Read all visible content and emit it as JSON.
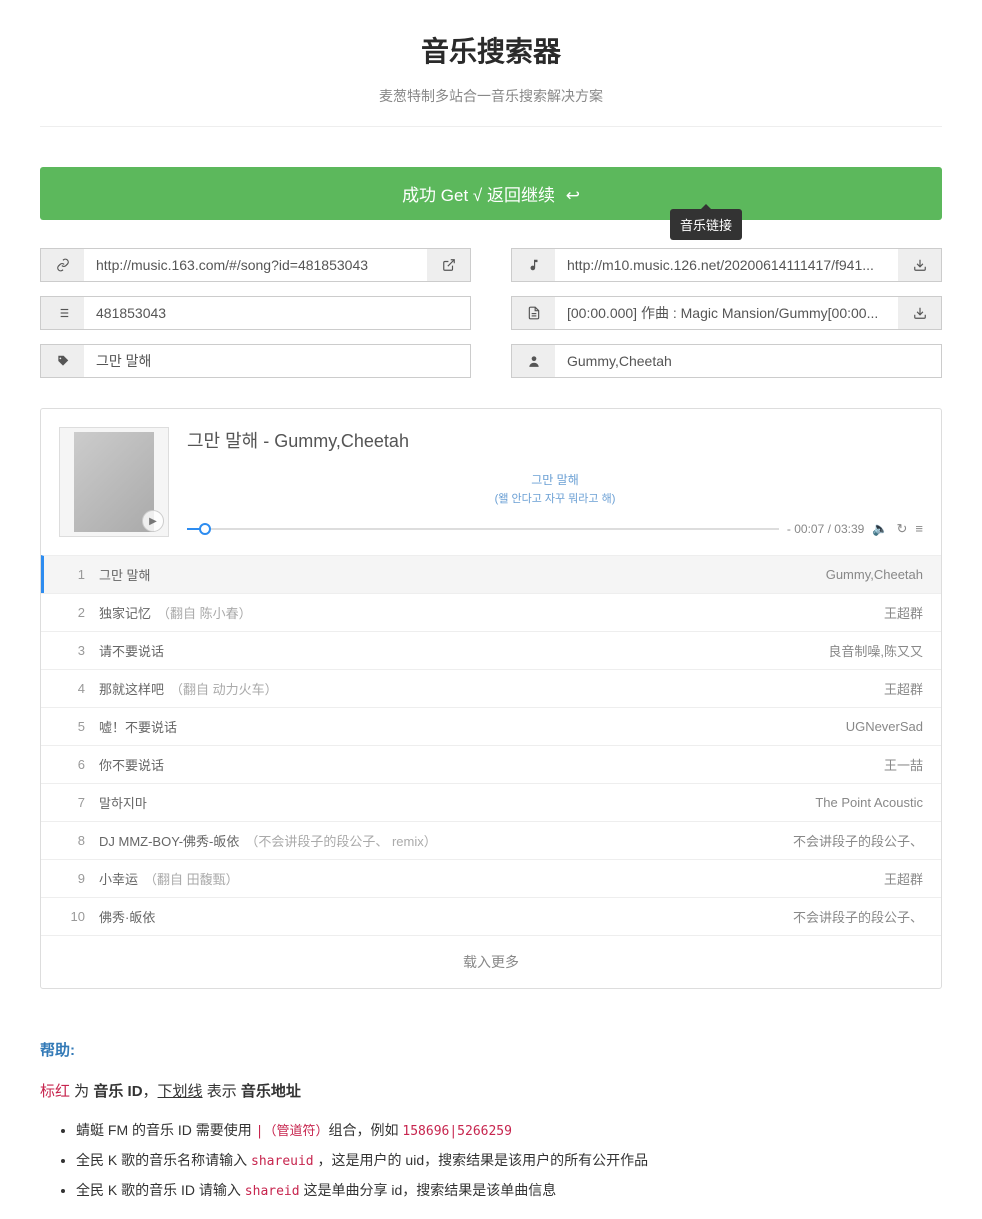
{
  "header": {
    "title": "音乐搜索器",
    "subtitle": "麦葱特制多站合一音乐搜索解决方案"
  },
  "alert": {
    "text": "成功 Get √ 返回继续 ",
    "tooltip": "音乐链接"
  },
  "fields": {
    "song_url": "http://music.163.com/#/song?id=481853043",
    "song_id": "481853043",
    "song_name": "그만 말해",
    "music_url": "http://m10.music.126.net/20200614111417/f941...",
    "lyric": "[00:00.000] 作曲 : Magic Mansion/Gummy[00:00...",
    "artist": "Gummy,Cheetah"
  },
  "player": {
    "title": "그만 말해 - Gummy,Cheetah",
    "lyric1": "그만 말해",
    "lyric2": "(왤 안다고 자꾸 뭐라고 해)",
    "time": "- 00:07 / 03:39"
  },
  "playlist": [
    {
      "num": "1",
      "title": "그만 말해",
      "artist": "Gummy,Cheetah",
      "active": true
    },
    {
      "num": "2",
      "title": "独家记忆",
      "secondary": "（翻自 陈小春）",
      "artist": "王超群"
    },
    {
      "num": "3",
      "title": "请不要说话",
      "artist": "良音制噪,陈又又"
    },
    {
      "num": "4",
      "title": "那就这样吧",
      "secondary": "（翻自 动力火车）",
      "artist": "王超群"
    },
    {
      "num": "5",
      "title": "嘘！不要说话",
      "artist": "UGNeverSad"
    },
    {
      "num": "6",
      "title": "你不要说话",
      "artist": "王一喆"
    },
    {
      "num": "7",
      "title": "말하지마",
      "artist": "The Point Acoustic"
    },
    {
      "num": "8",
      "title": "DJ MMZ-BOY-佛秀-皈依",
      "secondary": "（不会讲段子的段公子、 remix）",
      "artist": "不会讲段子的段公子、"
    },
    {
      "num": "9",
      "title": "小幸运",
      "secondary": "（翻自 田馥甄）",
      "artist": "王超群"
    },
    {
      "num": "10",
      "title": "佛秀·皈依",
      "artist": "不会讲段子的段公子、"
    }
  ],
  "load_more": "载入更多",
  "help": {
    "heading": "帮助:",
    "line_parts": {
      "p1": "标红",
      "p2": " 为 ",
      "p3": "音乐 ID",
      "p4": "，",
      "p5": "下划线",
      "p6": " 表示 ",
      "p7": "音乐地址"
    },
    "items": [
      {
        "pre": "蜻蜓 FM 的音乐 ID 需要使用 ",
        "code": "|（管道符）",
        "mid": "组合，例如 ",
        "code2": "158696|5266259"
      },
      {
        "pre": "全民 K 歌的音乐名称请输入 ",
        "code": "shareuid",
        "mid": " ，这是用户的 uid，搜索结果是该用户的所有公开作品"
      },
      {
        "pre": "全民 K 歌的音乐 ID 请输入 ",
        "code": "shareid",
        "mid": "  这是单曲分享 id，搜索结果是该单曲信息"
      }
    ]
  }
}
